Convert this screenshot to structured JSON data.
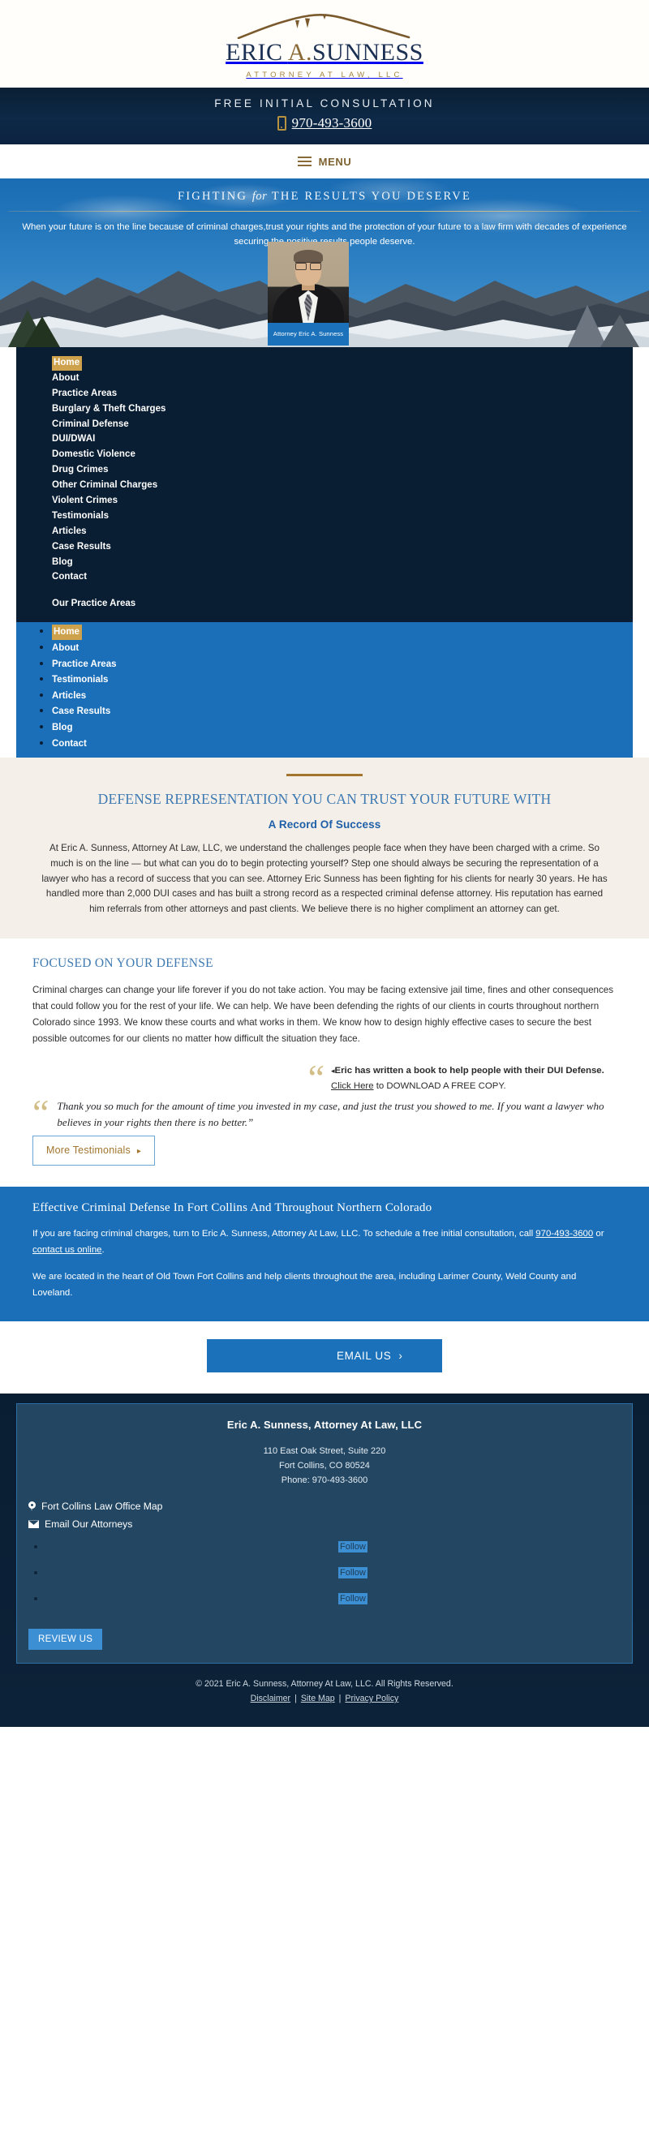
{
  "logo": {
    "name_part1": "E",
    "name_rest": "RIC ",
    "name_full_left": "ERIC ",
    "name_mid": "A.",
    "name_right": "SUNNESS",
    "tagline": "ATTORNEY AT LAW, LLC"
  },
  "consult": {
    "title": "FREE INITIAL CONSULTATION",
    "phone": "970-493-3600",
    "phone_icon": "mobile-phone-icon"
  },
  "menu": {
    "label": "MENU",
    "icon": "hamburger-icon"
  },
  "hero": {
    "title_a": "FIGHTING ",
    "title_i": "for",
    "title_b": " THE RESULTS YOU DESERVE",
    "subtitle": "When your future is on the line because of criminal charges,trust your rights and the protection of your future to a law firm with decades of experience securing the positive results people deserve.",
    "attorney_caption": "Attorney Eric A. Sunness"
  },
  "nav_primary": {
    "items": [
      {
        "label": "Home",
        "active": true
      },
      {
        "label": "About",
        "active": false
      },
      {
        "label": "Practice Areas",
        "active": false
      },
      {
        "label": "Burglary & Theft Charges",
        "active": false
      },
      {
        "label": "Criminal Defense",
        "active": false
      },
      {
        "label": "DUI/DWAI",
        "active": false
      },
      {
        "label": "Domestic Violence",
        "active": false
      },
      {
        "label": "Drug Crimes",
        "active": false
      },
      {
        "label": "Other Criminal Charges",
        "active": false
      },
      {
        "label": "Violent Crimes",
        "active": false
      },
      {
        "label": "Testimonials",
        "active": false
      },
      {
        "label": "Articles",
        "active": false
      },
      {
        "label": "Case Results",
        "active": false
      },
      {
        "label": "Blog",
        "active": false
      },
      {
        "label": "Contact",
        "active": false
      }
    ],
    "section_heading": "Our Practice Areas"
  },
  "nav_secondary": {
    "items": [
      {
        "label": "Home",
        "active": true
      },
      {
        "label": "About",
        "active": false
      },
      {
        "label": "Practice Areas",
        "active": false
      },
      {
        "label": "Testimonials",
        "active": false
      },
      {
        "label": "Articles",
        "active": false
      },
      {
        "label": "Case Results",
        "active": false
      },
      {
        "label": "Blog",
        "active": false
      },
      {
        "label": "Contact",
        "active": false
      }
    ]
  },
  "intro": {
    "heading": "DEFENSE REPRESENTATION YOU CAN TRUST YOUR FUTURE WITH",
    "subheading": "A Record Of Success",
    "body": "At Eric A. Sunness, Attorney At Law, LLC, we understand the challenges people face when they have been charged with a crime. So much is on the line — but what can you do to begin protecting yourself? Step one should always be securing the representation of a lawyer who has a record of success that you can see. Attorney Eric Sunness has been fighting for his clients for nearly 30 years. He has handled more than 2,000 DUI cases and has built a strong record as a respected criminal defense attorney. His reputation has earned him referrals from other attorneys and past clients. We believe there is no higher compliment an attorney can get."
  },
  "focused": {
    "heading": "FOCUSED ON YOUR DEFENSE",
    "body": "Criminal charges can change your life forever if you do not take action. You may be facing extensive jail time, fines and other consequences that could follow you for the rest of your life. We can help. We have been defending the rights of our clients in courts throughout northern Colorado since 1993. We know these courts and what works in them. We know how to design highly effective cases to secure the best possible outcomes for our clients no matter how difficult the situation they face."
  },
  "book": {
    "bold": "Eric has written a book to help people with their DUI Defense.",
    "link": "Click Here",
    "tail": " to DOWNLOAD A FREE COPY."
  },
  "testimonial": {
    "quote": "Thank you so much for the amount of time you invested in my case, and just the trust you showed to me. If you want a lawyer who believes in your rights then there is no better.”",
    "button": "More Testimonials",
    "button_chevron": "▸"
  },
  "cta": {
    "heading": "Effective Criminal Defense In Fort Collins And Throughout Northern Colorado",
    "p1_a": "If you are facing criminal charges, turn to Eric A. Sunness, Attorney At Law, LLC. To schedule a free initial consultation, call ",
    "p1_phone": "970-493-3600",
    "p1_b": " or ",
    "p1_link": "contact us online",
    "p1_c": ".",
    "p2": "We are located in the heart of Old Town Fort Collins and help clients throughout the area, including Larimer County, Weld County and Loveland.",
    "email_button": "EMAIL US",
    "email_chevron": "›"
  },
  "footer": {
    "firm": "Eric A. Sunness, Attorney At Law, LLC",
    "address_line1": "110 East Oak Street, Suite 220",
    "address_line2": "Fort Collins, CO 80524",
    "address_line3": "Phone: 970-493-3600",
    "map_link": "Fort Collins Law Office Map",
    "email_link": "Email Our Attorneys",
    "social": [
      {
        "label": "Follow"
      },
      {
        "label": "Follow"
      },
      {
        "label": "Follow"
      }
    ],
    "review_button": "REVIEW US",
    "copyright": "© 2021 Eric A. Sunness, Attorney At Law, LLC. All Rights Reserved.",
    "links": [
      {
        "label": "Disclaimer"
      },
      {
        "label": "Site Map"
      },
      {
        "label": "Privacy Policy"
      }
    ],
    "separator": "|"
  },
  "colors": {
    "navy": "#0a1e33",
    "blue": "#1b6fb8",
    "gold": "#a2762f",
    "gold_highlight": "#cea14c",
    "cream": "#f4efe9",
    "link_blue": "#3e7ab2"
  }
}
